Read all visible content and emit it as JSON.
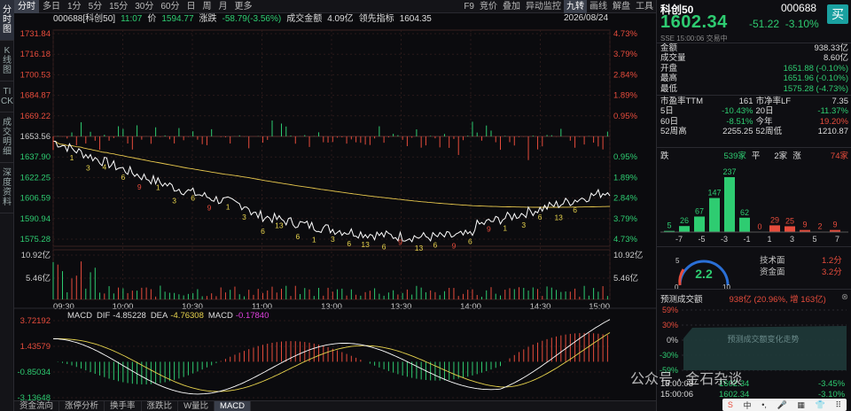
{
  "side_tabs": [
    "分时图",
    "K线图",
    "TICK",
    "成交明细",
    "深度资料"
  ],
  "top_tabs": [
    "分时",
    "多日",
    "1分",
    "5分",
    "15分",
    "30分",
    "60分",
    "日",
    "周",
    "月",
    "更多"
  ],
  "top_right_tabs": [
    "F9",
    "竞价",
    "叠加",
    "异动监控",
    "九转",
    "画线",
    "解盘",
    "工具"
  ],
  "info": {
    "code": "000688[科创50]",
    "time": "11:07",
    "price_label": "价",
    "price": "1594.77",
    "chg_label": "涨跌",
    "chg": "-58.79(-3.56%)",
    "amount_label": "成交金额",
    "amount": "4.09亿",
    "lead_label": "领先指标",
    "lead": "1604.35",
    "date": "2026/08/24"
  },
  "price_axis": {
    "left": [
      "1731.84",
      "1716.18",
      "1700.53",
      "1684.87",
      "1669.22",
      "1653.56",
      "1637.90",
      "1622.25",
      "1606.59",
      "1590.94",
      "1575.28"
    ],
    "right": [
      "4.73%",
      "3.79%",
      "2.84%",
      "1.89%",
      "0.95%",
      "",
      "0.95%",
      "1.89%",
      "2.84%",
      "3.79%",
      "4.73%"
    ]
  },
  "vol_axis": {
    "left": [
      "10.92亿",
      "5.46亿"
    ],
    "right": [
      "10.92亿",
      "5.46亿"
    ]
  },
  "time_axis": [
    "09:30",
    "10:00",
    "10:30",
    "11:00",
    "13:00",
    "13:30",
    "14:00",
    "14:30",
    "15:00"
  ],
  "macd": {
    "label": "MACD",
    "dif_label": "DIF",
    "dif": "-4.85228",
    "dea_label": "DEA",
    "dea": "-4.76308",
    "macd_label": "MACD",
    "macd": "-0.17840",
    "axis": [
      "3.72192",
      "1.43579",
      "-0.85034",
      "-3.13648"
    ]
  },
  "nine_turn": [
    "1",
    "3",
    "4",
    "6",
    "9",
    "1",
    "3",
    "6",
    "9",
    "1",
    "3",
    "6",
    "13",
    "6",
    "1",
    "3",
    "6",
    "13",
    "6",
    "9",
    "13",
    "6",
    "9",
    "6",
    "9",
    "1",
    "3",
    "6",
    "13",
    "6"
  ],
  "bottom_tabs": [
    "资金流向",
    "涨停分析",
    "换手率",
    "涨跌比",
    "W量比",
    "MACD"
  ],
  "right": {
    "name": "科创50",
    "code": "000688",
    "buy": "买",
    "price": "1602.34",
    "chg": "-51.22",
    "pct": "-3.10%",
    "sub": "SSE 15:00:06 交易中",
    "stats": [
      [
        "金额",
        "938.33亿"
      ],
      [
        "成交量",
        "8.60亿"
      ],
      [
        "开盘",
        "1651.88 (-0.10%)"
      ],
      [
        "最高",
        "1651.96 (-0.10%)"
      ],
      [
        "最低",
        "1575.28 (-4.73%)"
      ]
    ],
    "grid": [
      [
        "市盈率TTM",
        "161",
        "市净率LF",
        "7.35"
      ],
      [
        "5日",
        "-10.43%",
        "20日",
        "-11.37%"
      ],
      [
        "60日",
        "-8.51%",
        "今年",
        "19.20%"
      ],
      [
        "52周高",
        "2255.25",
        "52周低",
        "1210.87"
      ]
    ],
    "breadth": {
      "fall_label": "跌",
      "fall": "539家",
      "flat_label": "平",
      "flat": "2家",
      "rise_label": "涨",
      "rise": "74家"
    },
    "dist": {
      "cats": [
        "-7",
        "-5",
        "-3",
        "-1",
        "1",
        "3",
        "5",
        "7"
      ],
      "values": [
        5,
        26,
        67,
        147,
        237,
        62,
        0,
        29,
        25,
        9,
        2,
        9
      ],
      "bins": [
        "-9",
        "-8",
        "-7",
        "-6",
        "-5",
        "-4",
        "-3",
        "-2",
        "-1",
        "0",
        "1",
        "2"
      ]
    },
    "gauge": {
      "value": "2.2",
      "min": "0",
      "max": "10",
      "a": "5",
      "tech_label": "技术面",
      "tech": "1.2分",
      "fund_label": "资金面",
      "fund": "3.2分"
    },
    "forecast": {
      "label": "预测成交额",
      "value": "938亿 (20.96%, 增 163亿)",
      "axis": [
        "59%",
        "30%",
        "0%",
        "-30%",
        "-59%"
      ],
      "placeholder": "预测成交额变化走势",
      "time": "15:00:03",
      "time2": "15:00:06",
      "p1": "1602.34",
      "p2": "1602.34",
      "pct1": "-3.45%",
      "pct2": "-3.10%"
    },
    "watermark": "公众号 · 金石杂谈"
  },
  "colors": {
    "up": "#e74c3c",
    "down": "#2ecc71",
    "dif": "#ffffff",
    "dea": "#e8d44d",
    "macd": "#e040e0"
  }
}
